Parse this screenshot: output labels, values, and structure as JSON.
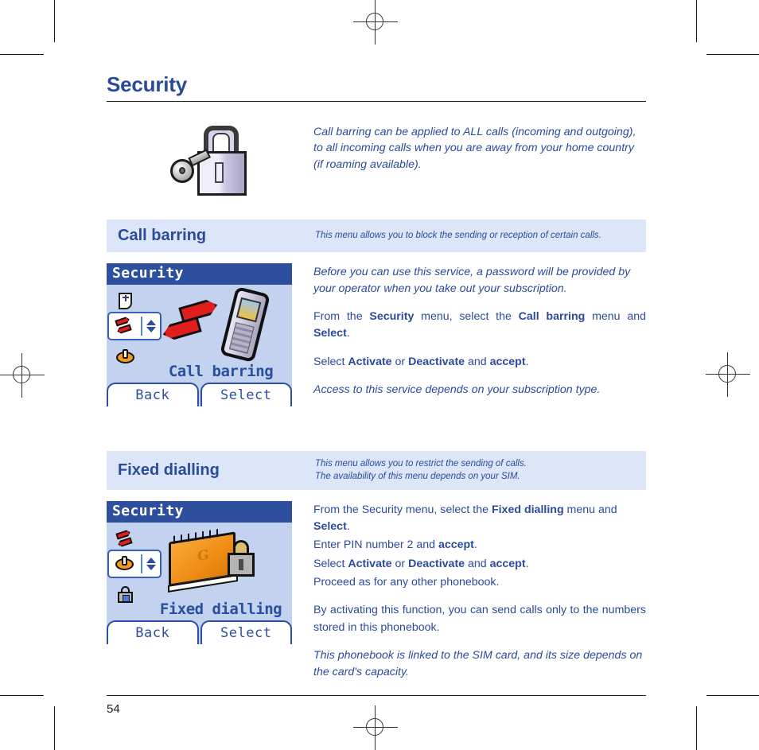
{
  "document": {
    "page_title": "Security",
    "page_number": "54"
  },
  "intro": {
    "icon": "key-padlock-icon",
    "text": "Call barring can be applied to ALL calls (incoming and outgoing), to all incoming calls when you are away from your home country (if roaming available)."
  },
  "sections": [
    {
      "id": "call-barring",
      "title": "Call barring",
      "note": "This menu allows you to block the sending or reception of certain calls.",
      "screenshot": {
        "titlebar": "Security",
        "caption": "Call barring",
        "softkey_left": "Back",
        "softkey_right": "Select",
        "rail_icons": [
          "page-icon",
          "red-arrows-icon",
          "orange-disc-icon"
        ],
        "illustration": "red-arrows-and-handset"
      },
      "paragraphs": [
        {
          "style": "italic",
          "runs": [
            {
              "text": "Before you can use this service, a password will be provided by your operator when you take out your subscription."
            }
          ]
        },
        {
          "style": "justified",
          "runs": [
            {
              "text": "From the "
            },
            {
              "text": "Security",
              "bold": true
            },
            {
              "text": " menu, select the "
            },
            {
              "text": "Call barring",
              "bold": true
            },
            {
              "text": " menu and "
            },
            {
              "text": "Select",
              "bold": true
            },
            {
              "text": "."
            }
          ]
        },
        {
          "style": "normal",
          "runs": [
            {
              "text": "Select "
            },
            {
              "text": "Activate",
              "bold": true
            },
            {
              "text": " or "
            },
            {
              "text": "Deactivate",
              "bold": true
            },
            {
              "text": " and "
            },
            {
              "text": "accept",
              "bold": true
            },
            {
              "text": "."
            }
          ]
        },
        {
          "style": "italic",
          "runs": [
            {
              "text": "Access to this service depends on your subscription type."
            }
          ]
        }
      ]
    },
    {
      "id": "fixed-dialling",
      "title": "Fixed dialling",
      "note": "This menu allows you to restrict the sending of calls.\nThe availability of this menu depends on your SIM.",
      "screenshot": {
        "titlebar": "Security",
        "caption": "Fixed dialling",
        "softkey_left": "Back",
        "softkey_right": "Select",
        "rail_icons": [
          "red-arrows-icon",
          "orange-disc-icon",
          "padlock-icon"
        ],
        "illustration": "orange-phonebook-and-padlock"
      },
      "paragraphs": [
        {
          "style": "tight",
          "runs": [
            {
              "text": "From the Security menu, select the "
            },
            {
              "text": "Fixed dialling",
              "bold": true
            },
            {
              "text": " menu and "
            },
            {
              "text": "Select",
              "bold": true
            },
            {
              "text": "."
            }
          ]
        },
        {
          "style": "tight",
          "runs": [
            {
              "text": "Enter PIN number 2 and "
            },
            {
              "text": "accept",
              "bold": true
            },
            {
              "text": "."
            }
          ]
        },
        {
          "style": "tight",
          "runs": [
            {
              "text": "Select "
            },
            {
              "text": "Activate",
              "bold": true
            },
            {
              "text": " or "
            },
            {
              "text": "Deactivate",
              "bold": true
            },
            {
              "text": " and "
            },
            {
              "text": "accept",
              "bold": true
            },
            {
              "text": "."
            }
          ]
        },
        {
          "style": "normal",
          "runs": [
            {
              "text": "Proceed as for any other phonebook."
            }
          ]
        },
        {
          "style": "justified",
          "runs": [
            {
              "text": "By activating this function, you can send calls only to the numbers stored in this phonebook."
            }
          ]
        },
        {
          "style": "italic",
          "runs": [
            {
              "text": "This phonebook is linked to the SIM card, and its size depends on the card's capacity."
            }
          ]
        }
      ]
    }
  ],
  "colors": {
    "heading_blue": "#2a4a9c",
    "band_background": "#dde6f8",
    "phone_screen_bg": "#c2d2ef",
    "phone_titlebar": "#2e4f9e",
    "accent_red": "#e01e1e",
    "accent_orange": "#f29a1e"
  }
}
